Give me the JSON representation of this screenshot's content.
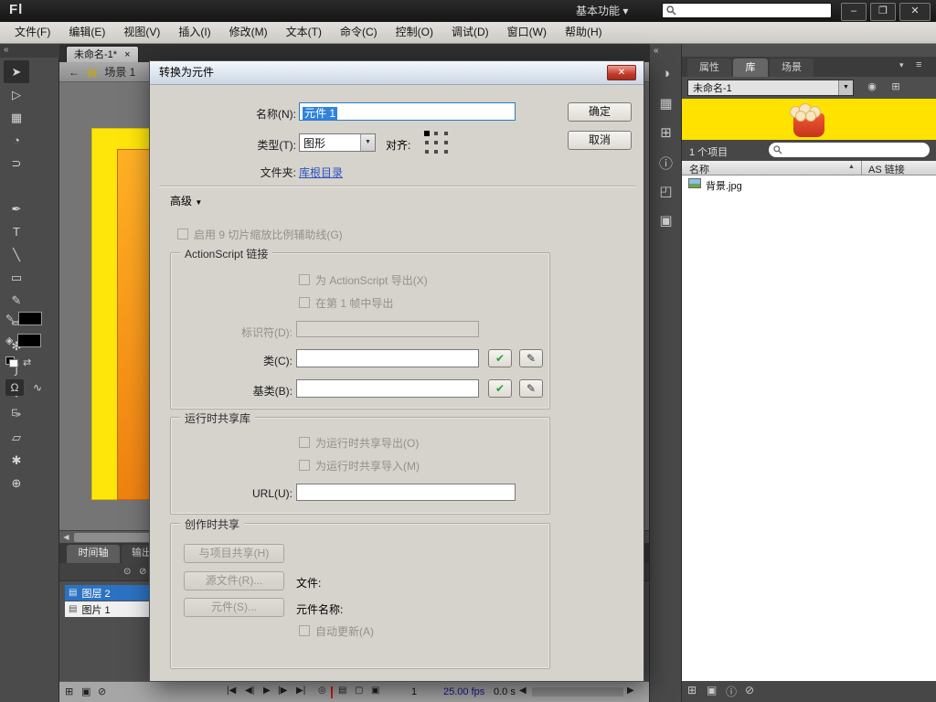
{
  "titlebar": {
    "logo": "Fl",
    "workspace": "基本功能",
    "dropdown_arrow": "▾",
    "search_value": "",
    "min_icon": "–",
    "restore_icon": "❐",
    "close_icon": "✕"
  },
  "menubar": {
    "items": [
      "文件(F)",
      "编辑(E)",
      "视图(V)",
      "插入(I)",
      "修改(M)",
      "文本(T)",
      "命令(C)",
      "控制(O)",
      "调试(D)",
      "窗口(W)",
      "帮助(H)"
    ]
  },
  "tools": {
    "collapse_icon": "«",
    "items": [
      {
        "name": "selection-tool",
        "glyph": "➤"
      },
      {
        "name": "subselection-tool",
        "glyph": "▷"
      },
      {
        "name": "free-transform-tool",
        "glyph": "▦"
      },
      {
        "name": "3d-rotation-tool",
        "glyph": "◔"
      },
      {
        "name": "lasso-tool",
        "glyph": "⊃"
      },
      {
        "name": "pen-tool",
        "glyph": "✒"
      },
      {
        "name": "text-tool",
        "glyph": "T"
      },
      {
        "name": "line-tool",
        "glyph": "╲"
      },
      {
        "name": "rectangle-tool",
        "glyph": "▭"
      },
      {
        "name": "pencil-tool",
        "glyph": "✎"
      },
      {
        "name": "brush-tool",
        "glyph": "✏"
      },
      {
        "name": "deco-tool",
        "glyph": "✻"
      },
      {
        "name": "bone-tool",
        "glyph": "∫"
      },
      {
        "name": "paint-bucket-tool",
        "glyph": "◈"
      },
      {
        "name": "eyedropper-tool",
        "glyph": "✑"
      },
      {
        "name": "eraser-tool",
        "glyph": "▱"
      },
      {
        "name": "hand-tool",
        "glyph": "✱"
      },
      {
        "name": "zoom-tool",
        "glyph": "⊕"
      }
    ],
    "stroke_icon": "✎",
    "fill_icon": "◈",
    "swap_icon": "⇄",
    "snap_icon": "Ω",
    "smooth_icon": "∿",
    "straighten_icon": "⌐"
  },
  "document": {
    "tab_title": "未命名-1*",
    "tab_close_icon": "×",
    "back_icon": "←",
    "scene_icon": "▤",
    "scene_label": "场景 1"
  },
  "stage": {
    "artwork": [
      "yellow-rectangle",
      "orange-rectangle"
    ],
    "colors": {
      "yellow": "#ffe60a",
      "orange": "#f08a11"
    }
  },
  "timeline": {
    "tabs": [
      "时间轴",
      "输出"
    ],
    "eye_icon": "⊙",
    "lock_icon": "⊘",
    "outline_icon": "▢",
    "layer_icon": "▤",
    "edit_pencil_icon": "✎",
    "layers": [
      "图层 2",
      "图片 1"
    ],
    "controls": {
      "new_layer_icon": "⊞",
      "new_folder_icon": "▣",
      "delete_icon": "⊘",
      "first_icon": "|◀",
      "prev_icon": "◀|",
      "play_icon": "▶",
      "next_icon": "|▶",
      "last_icon": "▶|",
      "center_frame_icon": "◎",
      "onion_icon": "▤",
      "onion_outline_icon": "▢",
      "edit_multi_icon": "▣",
      "frame": "1",
      "fps": "25.00 fps",
      "time": "0.0 s",
      "scroll_left_icon": "◀",
      "scroll_right_icon": "▶"
    }
  },
  "collapsed_panels": {
    "icons": [
      {
        "name": "color-panel",
        "glyph": "◑"
      },
      {
        "name": "swatches-panel",
        "glyph": "▦"
      },
      {
        "name": "align-panel",
        "glyph": "⊞"
      },
      {
        "name": "info-panel",
        "glyph": "ⓘ"
      },
      {
        "name": "transform-panel",
        "glyph": "◰"
      },
      {
        "name": "code-snippets-panel",
        "glyph": "▣"
      }
    ]
  },
  "library": {
    "tabs": [
      "属性",
      "库",
      "场景"
    ],
    "panel_arrow_icon": "▾",
    "panel_menu_icon": "≡",
    "doc_select_value": "未命名-1",
    "select_arrow": "▼",
    "pin_icon": "◉",
    "new_panel_icon": "⊞",
    "count": "1 个项目",
    "search_value": "",
    "name_col": "名称",
    "as_col": "AS 链接",
    "sort_icon": "▲",
    "items": [
      {
        "name": "背景.jpg",
        "type": "bitmap"
      }
    ],
    "footer": {
      "new_symbol_icon": "⊞",
      "new_folder_icon": "▣",
      "properties_icon": "ⓘ",
      "delete_icon": "⊘"
    }
  },
  "dialog": {
    "title": "转换为元件",
    "close_icon": "✕",
    "name_label": "名称(N):",
    "name_value": "元件 1",
    "ok_label": "确定",
    "cancel_label": "取消",
    "type_label": "类型(T):",
    "type_value": "图形",
    "combo_arrow": "▼",
    "align_label": "对齐:",
    "folder_label": "文件夹:",
    "folder_link": "库根目录",
    "advanced_label": "高级",
    "advanced_arrow": "▼",
    "scale9_label": "启用 9 切片缩放比例辅助线(G)",
    "as_group": {
      "title": "ActionScript 链接",
      "export_label": "为 ActionScript 导出(X)",
      "frame_label": "在第 1 帧中导出",
      "identifier_label": "标识符(D):",
      "identifier_value": "",
      "class_label": "类(C):",
      "class_value": "",
      "base_label": "基类(B):",
      "base_value": "",
      "check_icon": "✔",
      "edit_icon": "✎"
    },
    "runtime_group": {
      "title": "运行时共享库",
      "export_label": "为运行时共享导出(O)",
      "import_label": "为运行时共享导入(M)",
      "url_label": "URL(U):",
      "url_value": ""
    },
    "authoring_group": {
      "title": "创作时共享",
      "project_button": "与项目共享(H)",
      "source_button": "源文件(R)...",
      "file_label": "文件:",
      "symbol_button": "元件(S)...",
      "symbol_name_label": "元件名称:",
      "auto_update_label": "自动更新(A)"
    }
  }
}
